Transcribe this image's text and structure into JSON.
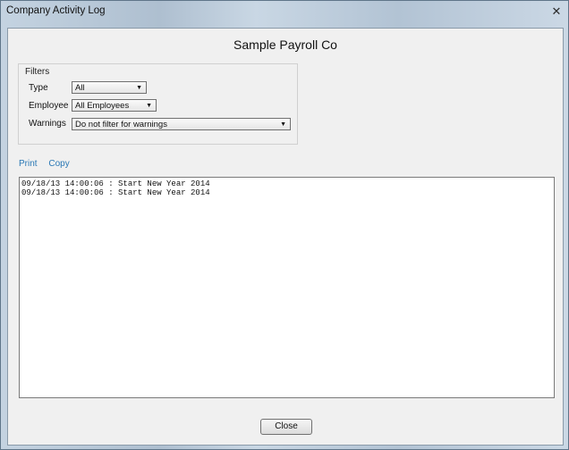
{
  "window": {
    "title": "Company Activity Log",
    "close_glyph": "✕"
  },
  "header": {
    "company_name": "Sample Payroll Co"
  },
  "filters": {
    "legend": "Filters",
    "type": {
      "label": "Type",
      "value": "All"
    },
    "employee": {
      "label": "Employee",
      "value": "All Employees"
    },
    "warnings": {
      "label": "Warnings",
      "value": "Do not filter for warnings"
    }
  },
  "actions": {
    "print": "Print",
    "copy": "Copy"
  },
  "log": {
    "lines": [
      "09/18/13 14:00:06 : Start New Year 2014",
      "09/18/13 14:00:06 : Start New Year 2014"
    ]
  },
  "footer": {
    "close_label": "Close"
  }
}
